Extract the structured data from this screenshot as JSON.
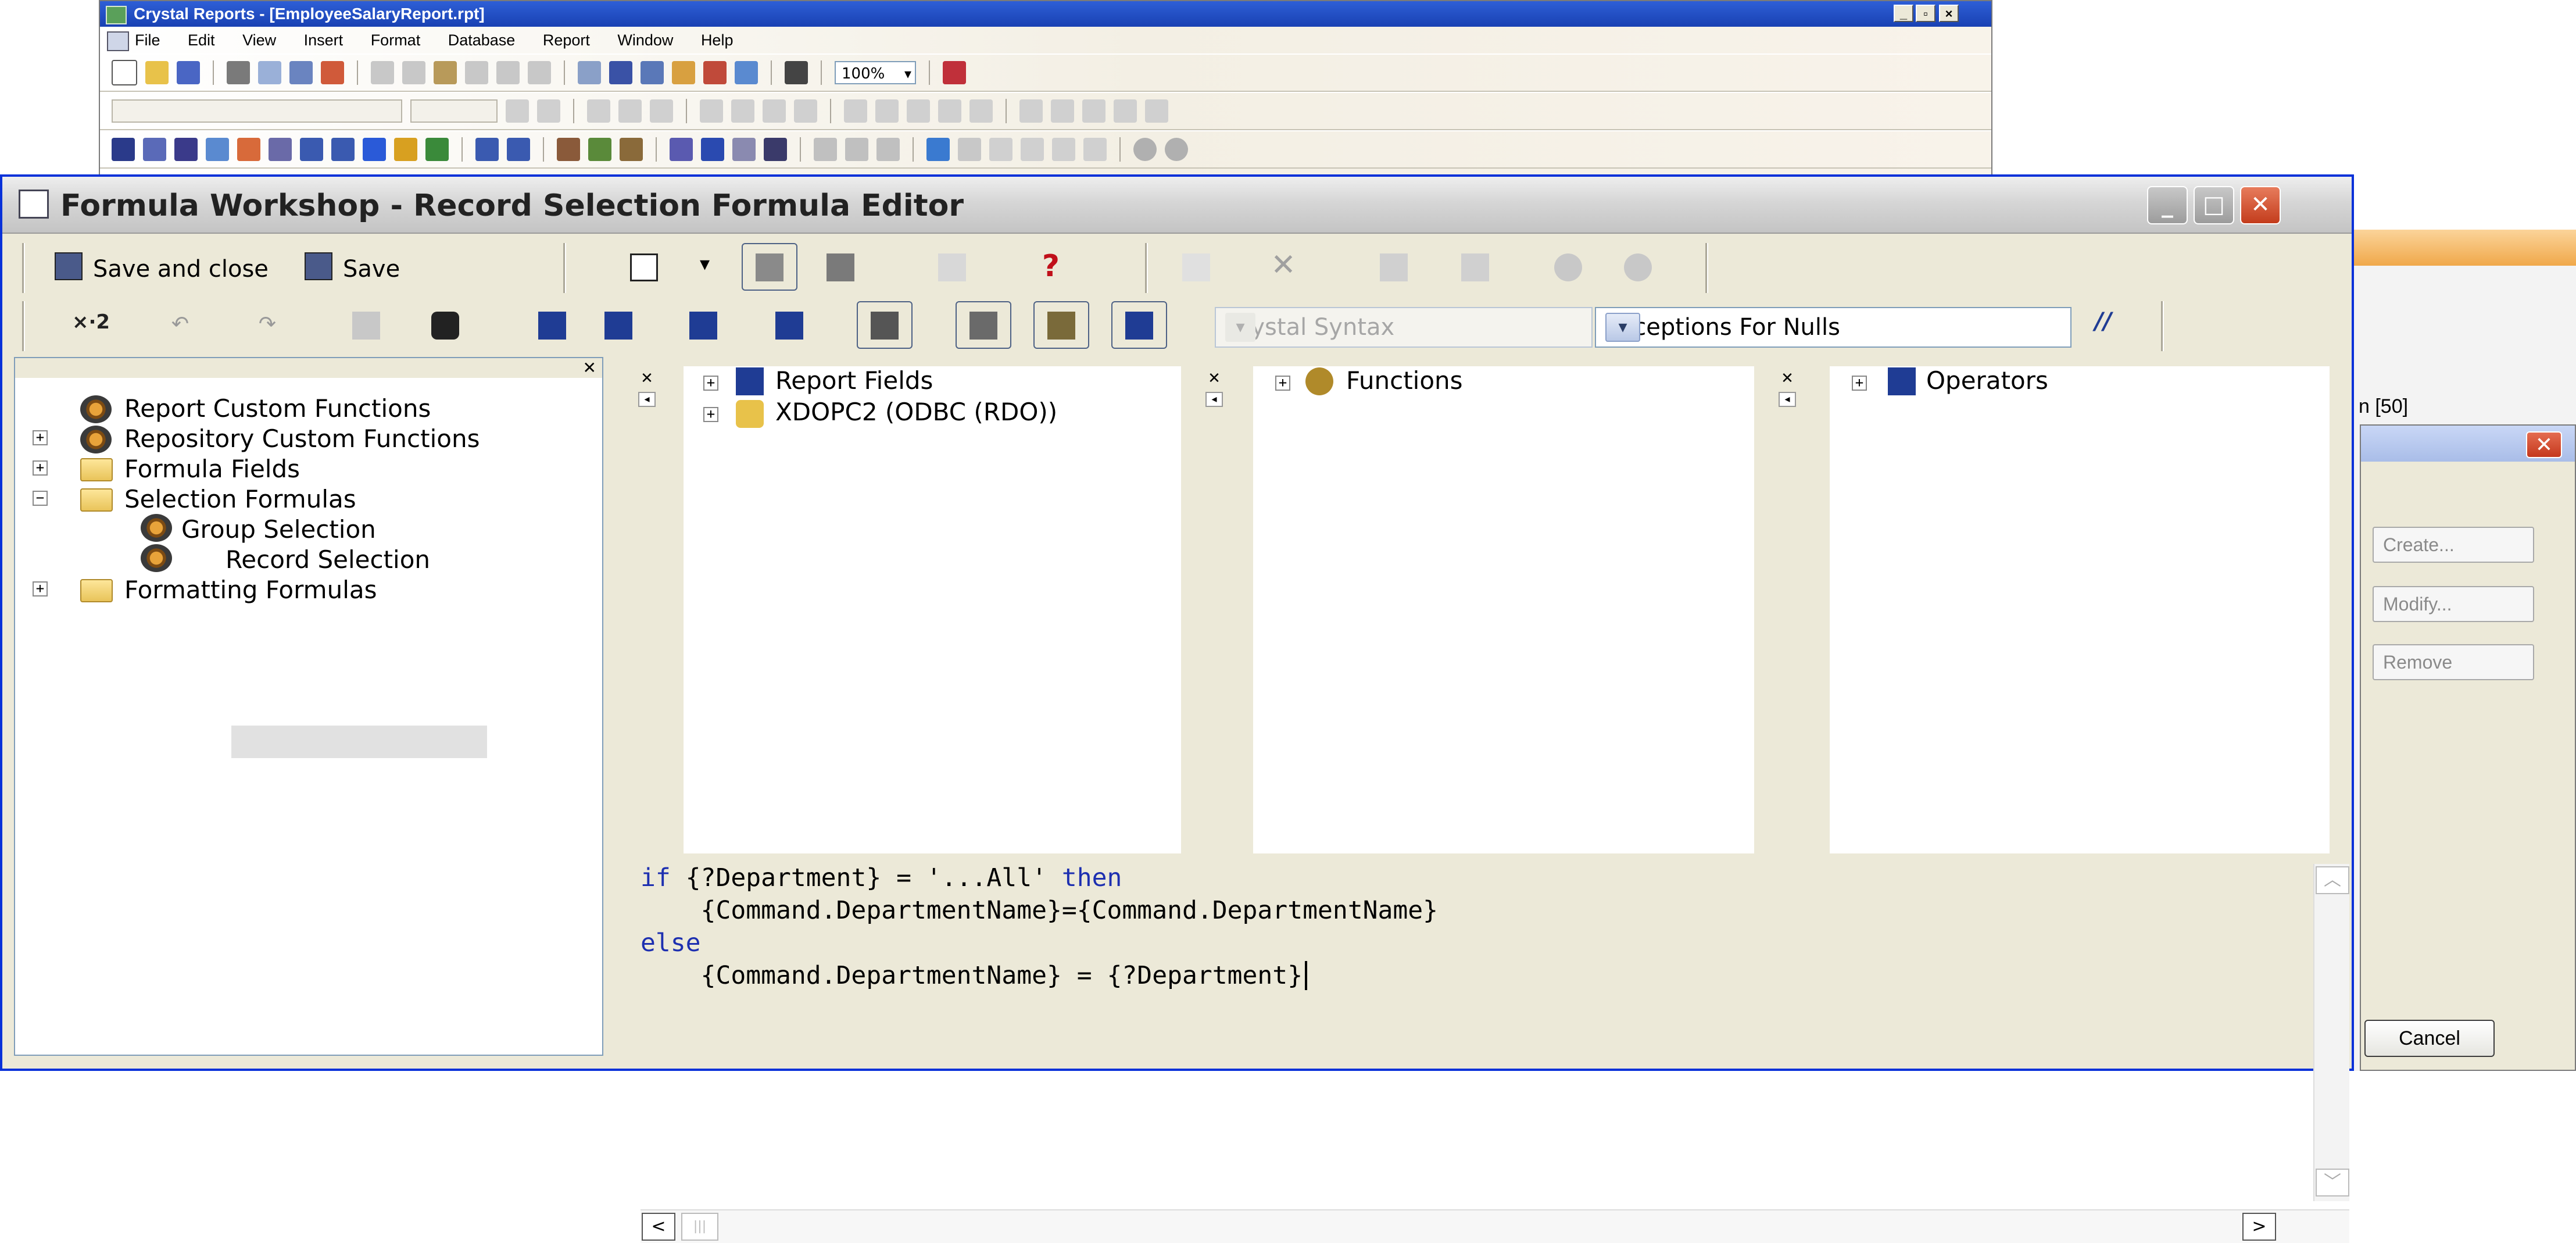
{
  "background_window": {
    "title": "Crystal Reports - [EmployeeSalaryReport.rpt]",
    "menu": [
      "File",
      "Edit",
      "View",
      "Insert",
      "Format",
      "Database",
      "Report",
      "Window",
      "Help"
    ],
    "zoom": "100%",
    "controls": [
      "_",
      "▫",
      "×"
    ]
  },
  "formula_workshop": {
    "title": "Formula Workshop - Record Selection Formula Editor",
    "toolbar1": {
      "save_and_close": "Save and close",
      "save": "Save"
    },
    "toolbar2": {
      "syntax": "Crystal Syntax",
      "null_handling": "Exceptions For Nulls",
      "comment": "//"
    },
    "tree": [
      {
        "label": "Report Custom Functions",
        "level": 0,
        "expander": ""
      },
      {
        "label": "Repository Custom Functions",
        "level": 0,
        "expander": "+"
      },
      {
        "label": "Formula Fields",
        "level": 0,
        "expander": "+"
      },
      {
        "label": "Selection Formulas",
        "level": 0,
        "expander": "−"
      },
      {
        "label": "Group Selection",
        "level": 1,
        "expander": ""
      },
      {
        "label": "Record Selection",
        "level": 1,
        "expander": "",
        "selected": true
      },
      {
        "label": "Formatting Formulas",
        "level": 0,
        "expander": "+"
      }
    ],
    "fields_panel": {
      "items": [
        "Report Fields",
        "XDOPC2 (ODBC (RDO))"
      ]
    },
    "functions_panel": {
      "items": [
        "Functions"
      ]
    },
    "operators_panel": {
      "items": [
        "Operators"
      ]
    },
    "code": {
      "line1_kw1": "if",
      "line1_mid": " {?Department} = '...All' ",
      "line1_kw2": "then",
      "line2": "    {Command.DepartmentName}={Command.DepartmentName}",
      "line3_kw": "else",
      "line4": "    {Command.DepartmentName} = {?Department}"
    }
  },
  "right_dialog": {
    "partial_text": "n [50]",
    "buttons": [
      "Create...",
      "Modify...",
      "Remove"
    ],
    "cancel": "Cancel"
  }
}
